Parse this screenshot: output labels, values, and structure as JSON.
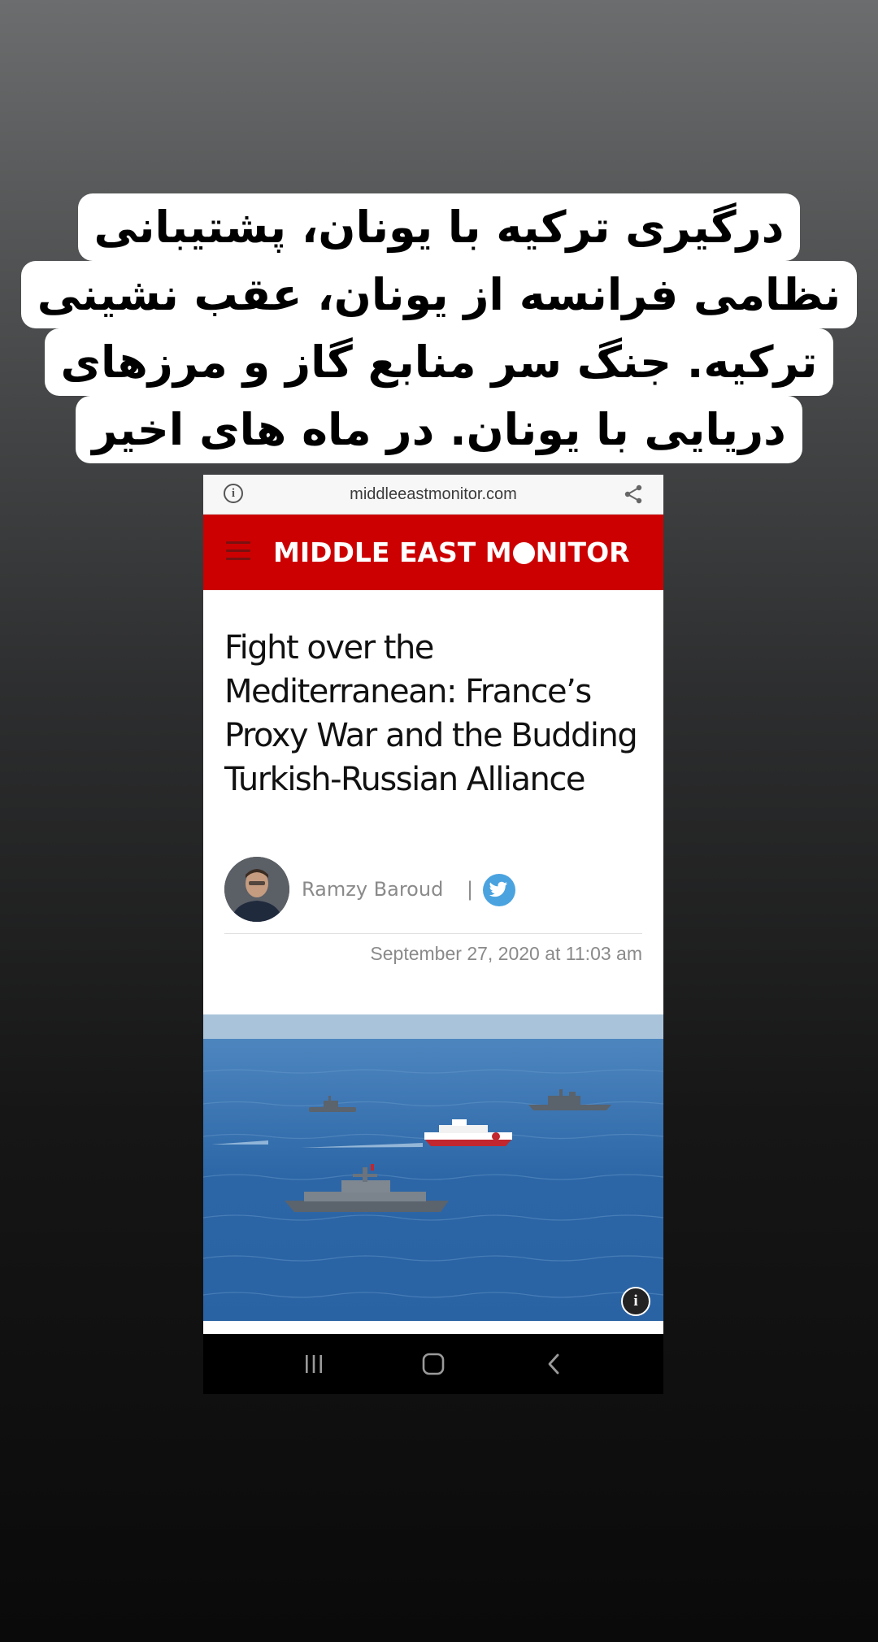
{
  "caption": {
    "lines": [
      "درگیری ترکیه با یونان، پشتیبانی",
      "نظامی فرانسه از یونان، عقب نشینی",
      "ترکیه. جنگ سر منابع گاز و مرزهای",
      "دریایی با یونان. در ماه های اخیر"
    ]
  },
  "browser": {
    "url": "middleeastmonitor.com",
    "info_icon": "info-icon",
    "share_icon": "share-icon"
  },
  "site": {
    "logo_left": "MIDDLE EAST M",
    "logo_right": "NITOR",
    "brand_color": "#cc0000",
    "menu_icon": "hamburger-menu-icon"
  },
  "article": {
    "headline": "Fight over the Mediterranean: France’s Proxy War and the Budding Turkish-Russian Alliance",
    "author": "Ramzy Baroud",
    "separator": "|",
    "social_icon": "twitter-icon",
    "date": "September 27, 2020 at 11:03 am",
    "photo_info_glyph": "i"
  },
  "system_nav": {
    "recents_icon": "recents-icon",
    "home_icon": "home-icon",
    "back_icon": "back-icon"
  }
}
